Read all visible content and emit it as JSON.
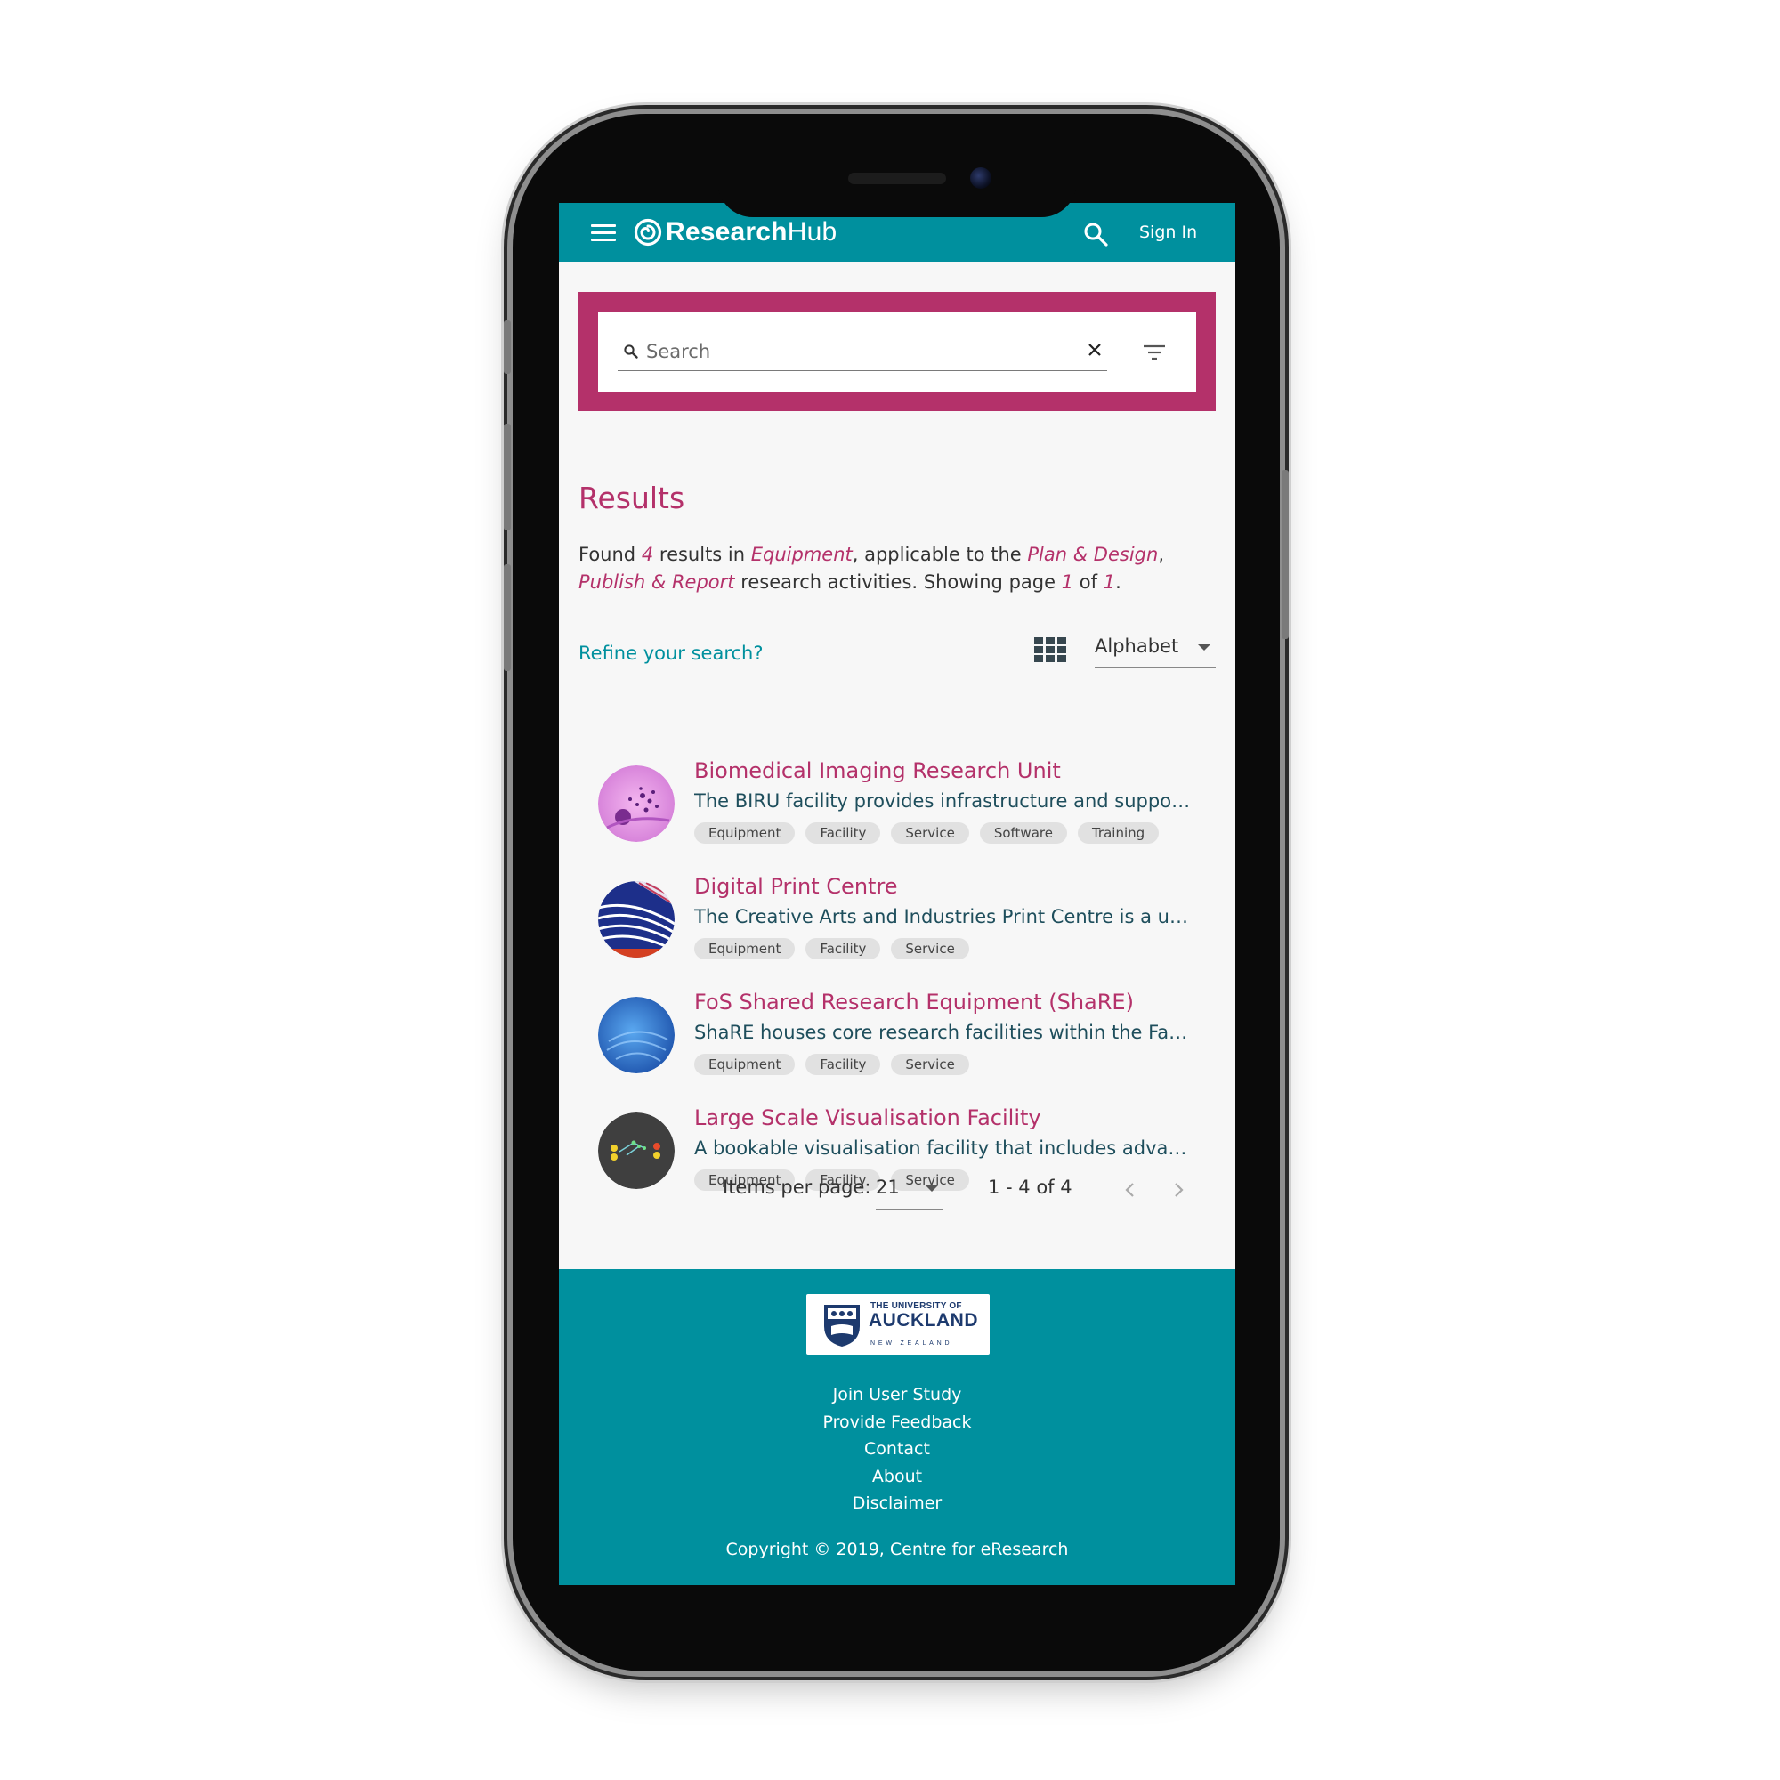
{
  "appbar": {
    "brand_bold": "Research",
    "brand_light": "Hub",
    "signin_label": "Sign In"
  },
  "search": {
    "placeholder": "Search",
    "value": ""
  },
  "results": {
    "title": "Results",
    "summary": {
      "found": "Found",
      "count": "4",
      "results_in": "results in",
      "category": "Equipment",
      "applicable": ", applicable to the",
      "activity1": "Plan & Design",
      "comma": ",",
      "activity2": "Publish & Report",
      "research": "research activities. Showing page",
      "page": "1",
      "of": "of",
      "total_pages": "1",
      "period": "."
    },
    "refine_label": "Refine your search?",
    "sort_value": "Alphabet",
    "items": [
      {
        "title": "Biomedical Imaging Research Unit",
        "desc": "The BIRU facility provides infrastructure and support for biomedical imaging",
        "tags": [
          "Equipment",
          "Facility",
          "Service",
          "Software",
          "Training"
        ]
      },
      {
        "title": "Digital Print Centre",
        "desc": "The Creative Arts and Industries Print Centre is a unique facility",
        "tags": [
          "Equipment",
          "Facility",
          "Service"
        ]
      },
      {
        "title": "FoS Shared Research Equipment (ShaRE)",
        "desc": "ShaRE houses core research facilities within the Faculty of Science",
        "tags": [
          "Equipment",
          "Facility",
          "Service"
        ]
      },
      {
        "title": "Large Scale Visualisation Facility",
        "desc": "A bookable visualisation facility that includes advanced display systems",
        "tags": [
          "Equipment",
          "Facility",
          "Service"
        ]
      }
    ]
  },
  "pager": {
    "items_per_page_label": "Items per page:",
    "items_per_page_value": "21",
    "range": "1 - 4 of 4"
  },
  "footer": {
    "logo": {
      "line1": "THE UNIVERSITY OF",
      "line2": "AUCKLAND",
      "line3": "NEW ZEALAND"
    },
    "links": [
      "Join User Study",
      "Provide Feedback",
      "Contact",
      "About",
      "Disclaimer"
    ],
    "copyright": "Copyright © 2019, Centre for eResearch"
  },
  "colors": {
    "teal": "#00909e",
    "magenta": "#b4316a"
  }
}
